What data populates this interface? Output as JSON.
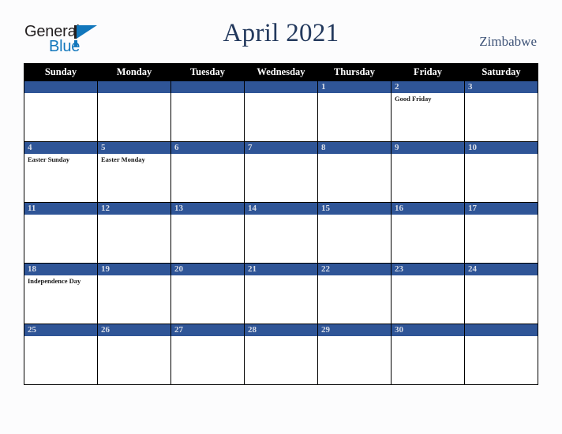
{
  "brand": {
    "name_part1": "General",
    "name_part2": "Blue",
    "accent_color": "#1277bc",
    "dark_color": "#231f20"
  },
  "header": {
    "title": "April 2021",
    "country": "Zimbabwe",
    "title_color": "#23395d",
    "country_color": "#3d5277"
  },
  "calendar": {
    "header_bg": "#000000",
    "daybar_bg": "#2f5597",
    "daynumber_color": "#d9dde7",
    "weekday_headers": [
      "Sunday",
      "Monday",
      "Tuesday",
      "Wednesday",
      "Thursday",
      "Friday",
      "Saturday"
    ],
    "weeks": [
      [
        {
          "day": "",
          "events": []
        },
        {
          "day": "",
          "events": []
        },
        {
          "day": "",
          "events": []
        },
        {
          "day": "",
          "events": []
        },
        {
          "day": "1",
          "events": []
        },
        {
          "day": "2",
          "events": [
            "Good Friday"
          ]
        },
        {
          "day": "3",
          "events": []
        }
      ],
      [
        {
          "day": "4",
          "events": [
            "Easter Sunday"
          ]
        },
        {
          "day": "5",
          "events": [
            "Easter Monday"
          ]
        },
        {
          "day": "6",
          "events": []
        },
        {
          "day": "7",
          "events": []
        },
        {
          "day": "8",
          "events": []
        },
        {
          "day": "9",
          "events": []
        },
        {
          "day": "10",
          "events": []
        }
      ],
      [
        {
          "day": "11",
          "events": []
        },
        {
          "day": "12",
          "events": []
        },
        {
          "day": "13",
          "events": []
        },
        {
          "day": "14",
          "events": []
        },
        {
          "day": "15",
          "events": []
        },
        {
          "day": "16",
          "events": []
        },
        {
          "day": "17",
          "events": []
        }
      ],
      [
        {
          "day": "18",
          "events": [
            "Independence Day"
          ]
        },
        {
          "day": "19",
          "events": []
        },
        {
          "day": "20",
          "events": []
        },
        {
          "day": "21",
          "events": []
        },
        {
          "day": "22",
          "events": []
        },
        {
          "day": "23",
          "events": []
        },
        {
          "day": "24",
          "events": []
        }
      ],
      [
        {
          "day": "25",
          "events": []
        },
        {
          "day": "26",
          "events": []
        },
        {
          "day": "27",
          "events": []
        },
        {
          "day": "28",
          "events": []
        },
        {
          "day": "29",
          "events": []
        },
        {
          "day": "30",
          "events": []
        },
        {
          "day": "",
          "events": []
        }
      ]
    ]
  }
}
